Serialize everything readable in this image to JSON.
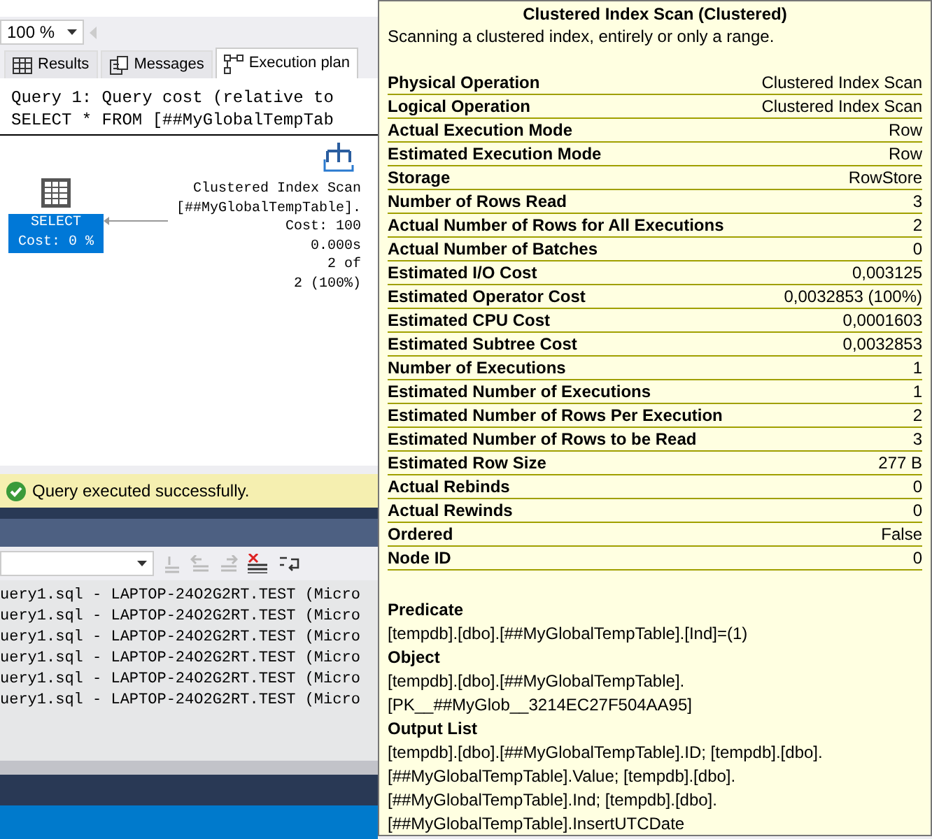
{
  "zoom": {
    "value": "100 %"
  },
  "tabs": [
    {
      "label": "Results",
      "kind": "grid",
      "selected": false
    },
    {
      "label": "Messages",
      "kind": "messages",
      "selected": false
    },
    {
      "label": "Execution plan",
      "kind": "plan",
      "selected": true
    }
  ],
  "query_header": [
    "Query 1: Query cost (relative to",
    "SELECT * FROM [##MyGlobalTempTab"
  ],
  "plan": {
    "select_node": {
      "label": "SELECT",
      "cost": "Cost: 0 %",
      "selected": true
    },
    "scan_node": {
      "lines": [
        "Clustered Index Scan",
        "[##MyGlobalTempTable].",
        "Cost: 100",
        "0.000s",
        "2 of",
        "2 (100%)"
      ]
    }
  },
  "status": "Query executed successfully.",
  "output_lines": [
    "uery1.sql - LAPTOP-24O2G2RT.TEST (Micro",
    "uery1.sql - LAPTOP-24O2G2RT.TEST (Micro",
    "uery1.sql - LAPTOP-24O2G2RT.TEST (Micro",
    "uery1.sql - LAPTOP-24O2G2RT.TEST (Micro",
    "uery1.sql - LAPTOP-24O2G2RT.TEST (Micro",
    "uery1.sql - LAPTOP-24O2G2RT.TEST (Micro"
  ],
  "tooltip": {
    "title": "Clustered Index Scan (Clustered)",
    "description": "Scanning a clustered index, entirely or only a range.",
    "properties": [
      {
        "name": "Physical Operation",
        "value": "Clustered Index Scan"
      },
      {
        "name": "Logical Operation",
        "value": "Clustered Index Scan"
      },
      {
        "name": "Actual Execution Mode",
        "value": "Row"
      },
      {
        "name": "Estimated Execution Mode",
        "value": "Row"
      },
      {
        "name": "Storage",
        "value": "RowStore"
      },
      {
        "name": "Number of Rows Read",
        "value": "3"
      },
      {
        "name": "Actual Number of Rows for All Executions",
        "value": "2"
      },
      {
        "name": "Actual Number of Batches",
        "value": "0"
      },
      {
        "name": "Estimated I/O Cost",
        "value": "0,003125"
      },
      {
        "name": "Estimated Operator Cost",
        "value": "0,0032853 (100%)"
      },
      {
        "name": "Estimated CPU Cost",
        "value": "0,0001603"
      },
      {
        "name": "Estimated Subtree Cost",
        "value": "0,0032853"
      },
      {
        "name": "Number of Executions",
        "value": "1"
      },
      {
        "name": "Estimated Number of Executions",
        "value": "1"
      },
      {
        "name": "Estimated Number of Rows Per Execution",
        "value": "2"
      },
      {
        "name": "Estimated Number of Rows to be Read",
        "value": "3"
      },
      {
        "name": "Estimated Row Size",
        "value": "277 B"
      },
      {
        "name": "Actual Rebinds",
        "value": "0"
      },
      {
        "name": "Actual Rewinds",
        "value": "0"
      },
      {
        "name": "Ordered",
        "value": "False"
      },
      {
        "name": "Node ID",
        "value": "0"
      }
    ],
    "sections": [
      {
        "heading": "Predicate",
        "lines": [
          "[tempdb].[dbo].[##MyGlobalTempTable].[Ind]=(1)"
        ]
      },
      {
        "heading": "Object",
        "lines": [
          "[tempdb].[dbo].[##MyGlobalTempTable].",
          "[PK__##MyGlob__3214EC27F504AA95]"
        ]
      },
      {
        "heading": "Output List",
        "lines": [
          "[tempdb].[dbo].[##MyGlobalTempTable].ID; [tempdb].[dbo].",
          "[##MyGlobalTempTable].Value; [tempdb].[dbo].",
          "[##MyGlobalTempTable].Ind; [tempdb].[dbo].",
          "[##MyGlobalTempTable].InsertUTCDate"
        ]
      }
    ]
  }
}
